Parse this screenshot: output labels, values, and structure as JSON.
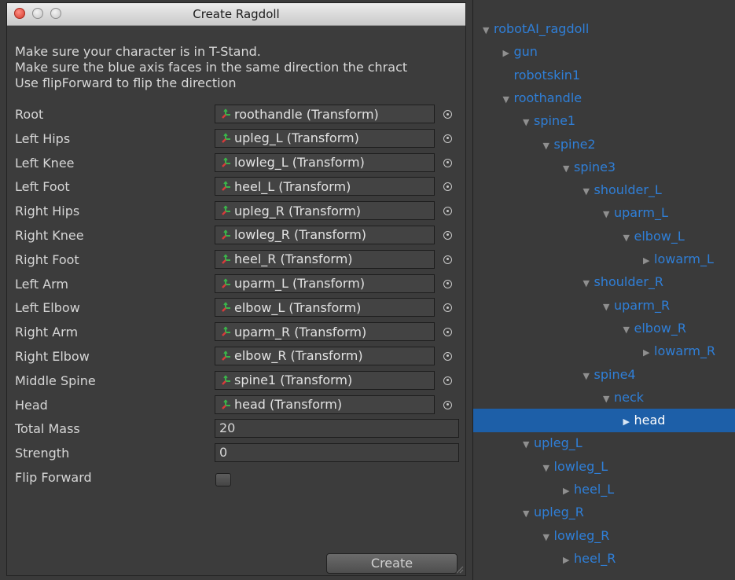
{
  "window": {
    "title": "Create Ragdoll"
  },
  "help": [
    "Make sure your character is in T-Stand.",
    "Make sure the blue axis faces in the same direction the chract",
    "Use flipForward to flip the direction"
  ],
  "bones": [
    {
      "label": "Root",
      "value": "roothandle (Transform)"
    },
    {
      "label": "Left Hips",
      "value": "upleg_L (Transform)"
    },
    {
      "label": "Left Knee",
      "value": "lowleg_L (Transform)"
    },
    {
      "label": "Left Foot",
      "value": "heel_L (Transform)"
    },
    {
      "label": "Right Hips",
      "value": "upleg_R (Transform)"
    },
    {
      "label": "Right Knee",
      "value": "lowleg_R (Transform)"
    },
    {
      "label": "Right Foot",
      "value": "heel_R (Transform)"
    },
    {
      "label": "Left Arm",
      "value": "uparm_L (Transform)"
    },
    {
      "label": "Left Elbow",
      "value": "elbow_L (Transform)"
    },
    {
      "label": "Right Arm",
      "value": "uparm_R (Transform)"
    },
    {
      "label": "Right Elbow",
      "value": "elbow_R (Transform)"
    },
    {
      "label": "Middle Spine",
      "value": "spine1 (Transform)"
    },
    {
      "label": "Head",
      "value": "head (Transform)"
    }
  ],
  "total_mass": {
    "label": "Total Mass",
    "value": "20"
  },
  "strength": {
    "label": "Strength",
    "value": "0"
  },
  "flip_forward": {
    "label": "Flip Forward",
    "checked": false
  },
  "create_button": "Create",
  "hierarchy": [
    {
      "name": "robotAI_ragdoll",
      "depth": 0,
      "arrow": "down"
    },
    {
      "name": "gun",
      "depth": 1,
      "arrow": "right"
    },
    {
      "name": "robotskin1",
      "depth": 1,
      "arrow": "none"
    },
    {
      "name": "roothandle",
      "depth": 1,
      "arrow": "down"
    },
    {
      "name": "spine1",
      "depth": 2,
      "arrow": "down"
    },
    {
      "name": "spine2",
      "depth": 3,
      "arrow": "down"
    },
    {
      "name": "spine3",
      "depth": 4,
      "arrow": "down"
    },
    {
      "name": "shoulder_L",
      "depth": 5,
      "arrow": "down"
    },
    {
      "name": "uparm_L",
      "depth": 6,
      "arrow": "down"
    },
    {
      "name": "elbow_L",
      "depth": 7,
      "arrow": "down"
    },
    {
      "name": "lowarm_L",
      "depth": 8,
      "arrow": "right"
    },
    {
      "name": "shoulder_R",
      "depth": 5,
      "arrow": "down"
    },
    {
      "name": "uparm_R",
      "depth": 6,
      "arrow": "down"
    },
    {
      "name": "elbow_R",
      "depth": 7,
      "arrow": "down"
    },
    {
      "name": "lowarm_R",
      "depth": 8,
      "arrow": "right"
    },
    {
      "name": "spine4",
      "depth": 5,
      "arrow": "down"
    },
    {
      "name": "neck",
      "depth": 6,
      "arrow": "down"
    },
    {
      "name": "head",
      "depth": 7,
      "arrow": "right",
      "selected": true
    },
    {
      "name": "upleg_L",
      "depth": 2,
      "arrow": "down"
    },
    {
      "name": "lowleg_L",
      "depth": 3,
      "arrow": "down"
    },
    {
      "name": "heel_L",
      "depth": 4,
      "arrow": "right"
    },
    {
      "name": "upleg_R",
      "depth": 2,
      "arrow": "down"
    },
    {
      "name": "lowleg_R",
      "depth": 3,
      "arrow": "down"
    },
    {
      "name": "heel_R",
      "depth": 4,
      "arrow": "right"
    }
  ],
  "colors": {
    "tree_text": "#2f7fd8",
    "selection": "#1d5fa8",
    "panel_bg": "#3c3c3c"
  }
}
